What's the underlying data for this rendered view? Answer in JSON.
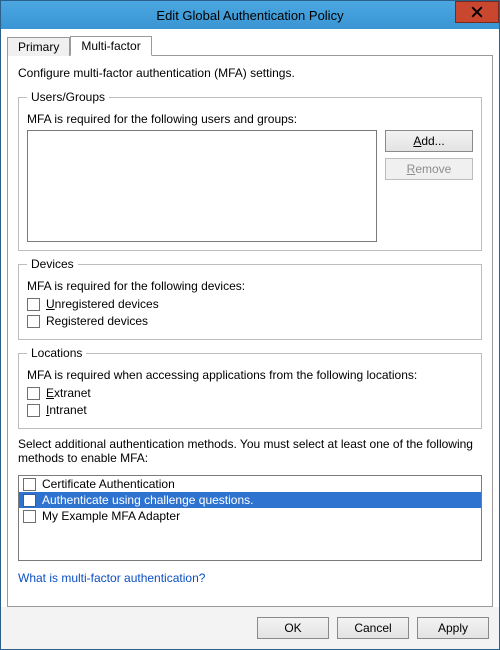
{
  "window": {
    "title": "Edit Global Authentication Policy"
  },
  "tabs": {
    "primary": "Primary",
    "multifactor": "Multi-factor",
    "active": "multifactor"
  },
  "intro": "Configure multi-factor authentication (MFA) settings.",
  "usersGroups": {
    "legend": "Users/Groups",
    "caption": "MFA is required for the following users and groups:",
    "addLabel": "Add...",
    "removeLabel": "Remove"
  },
  "devices": {
    "legend": "Devices",
    "caption": "MFA is required for the following devices:",
    "unregistered": "Unregistered devices",
    "registered": "Registered devices"
  },
  "locations": {
    "legend": "Locations",
    "caption": "MFA is required when accessing applications from the following locations:",
    "extranet": "Extranet",
    "intranet": "Intranet"
  },
  "methods": {
    "caption": "Select additional authentication methods. You must select at least one of the following methods to enable MFA:",
    "items": [
      {
        "label": "Certificate Authentication",
        "checked": false,
        "selected": false
      },
      {
        "label": "Authenticate using challenge questions.",
        "checked": false,
        "selected": true
      },
      {
        "label": "My Example MFA Adapter",
        "checked": false,
        "selected": false
      }
    ]
  },
  "link": "What is multi-factor authentication?",
  "footer": {
    "ok": "OK",
    "cancel": "Cancel",
    "apply": "Apply"
  }
}
